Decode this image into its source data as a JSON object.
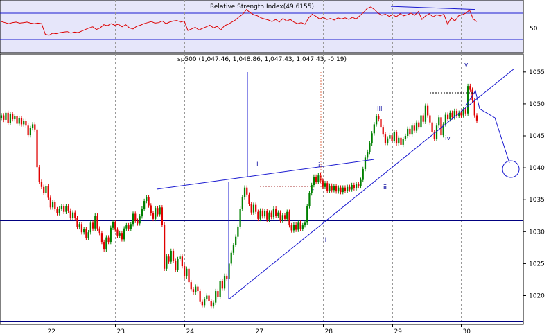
{
  "chart_data": [
    {
      "type": "line",
      "title": "Relative Strength Index(49.6155)",
      "y_ticks": [
        50
      ],
      "ylim": [
        0,
        100
      ],
      "reference_levels": [
        70,
        30
      ],
      "line_color": "#dd0000",
      "background": "#e6e6fa",
      "series": [
        {
          "values": [
            59,
            57,
            55,
            57,
            58,
            56,
            57,
            58,
            56,
            55,
            56,
            55,
            35,
            33,
            37,
            36,
            38,
            39,
            40,
            37,
            39,
            38,
            41,
            44,
            47,
            49,
            44,
            47,
            53,
            51,
            55,
            52,
            54,
            49,
            53,
            47,
            45,
            50,
            52,
            55,
            57,
            59,
            56,
            57,
            60,
            55,
            58,
            60,
            61,
            58,
            60,
            42,
            45,
            48,
            43,
            46,
            49,
            52,
            47,
            50,
            43,
            51,
            54,
            58,
            62,
            68,
            73,
            82,
            76,
            72,
            70,
            66,
            64,
            62,
            59,
            63,
            58,
            65,
            60,
            63,
            58,
            55,
            57,
            54,
            66,
            73,
            69,
            64,
            67,
            63,
            65,
            62,
            66,
            64,
            66,
            63,
            67,
            64,
            70,
            76,
            84,
            87,
            82,
            75,
            71,
            73,
            69,
            72,
            68,
            74,
            70,
            72,
            75,
            71,
            78,
            63,
            70,
            74,
            68,
            72,
            70,
            73,
            54,
            66,
            60,
            70,
            72,
            75,
            81,
            64,
            59
          ]
        }
      ],
      "trendlines": [
        {
          "x1": 119,
          "y1": 88,
          "x2": 142,
          "y2": 82
        }
      ]
    },
    {
      "type": "candlestick",
      "title": "sp500 (1,047.46, 1,048.86, 1,047.43, 1,047.43, -0.19)",
      "x_tick_labels": [
        "22",
        "23",
        "24",
        "27",
        "28",
        "29",
        "30"
      ],
      "y_ticks": [
        1020,
        1025,
        1030,
        1035,
        1040,
        1045,
        1050,
        1055
      ],
      "ylim": [
        1015.5,
        1057.8
      ],
      "up_color": "#008000",
      "down_color": "#e00000",
      "horizontal_levels": [
        {
          "value": 1055.2,
          "color": "#000080"
        },
        {
          "value": 1038.6,
          "color": "#66bb66"
        },
        {
          "value": 1031.8,
          "color": "#000080"
        },
        {
          "value": 1016.0,
          "color": "#000080"
        }
      ],
      "series": [
        {
          "name": "close",
          "values": [
            1048.2,
            1047.5,
            1048.6,
            1047.0,
            1048.4,
            1047.6,
            1048.1,
            1046.9,
            1047.8,
            1046.8,
            1047.3,
            1046.6,
            1045.1,
            1046.2,
            1046.8,
            1046.0,
            1040.1,
            1037.8,
            1037.0,
            1036.1,
            1037.1,
            1035.3,
            1033.8,
            1034.6,
            1033.5,
            1032.9,
            1033.6,
            1034.0,
            1033.1,
            1034.0,
            1033.3,
            1032.2,
            1033.0,
            1032.1,
            1030.7,
            1031.2,
            1029.9,
            1030.4,
            1029.0,
            1029.9,
            1031.4,
            1030.5,
            1032.5,
            1030.5,
            1029.8,
            1028.4,
            1027.2,
            1029.1,
            1028.4,
            1030.6,
            1031.5,
            1030.3,
            1029.4,
            1029.8,
            1028.8,
            1030.5,
            1031.0,
            1030.4,
            1031.2,
            1032.8,
            1031.7,
            1031.3,
            1032.4,
            1033.6,
            1034.8,
            1035.4,
            1034.1,
            1032.9,
            1032.0,
            1033.7,
            1032.7,
            1033.8,
            1031.1,
            1024.2,
            1026.1,
            1025.3,
            1027.0,
            1025.4,
            1024.0,
            1025.7,
            1026.1,
            1024.6,
            1023.0,
            1024.2,
            1022.1,
            1021.0,
            1020.5,
            1021.4,
            1020.7,
            1019.0,
            1018.5,
            1019.4,
            1020.0,
            1019.1,
            1018.3,
            1018.9,
            1020.7,
            1019.8,
            1022.3,
            1021.1,
            1023.1,
            1022.6,
            1025.0,
            1026.7,
            1027.9,
            1029.2,
            1030.8,
            1033.6,
            1035.4,
            1036.9,
            1035.8,
            1034.3,
            1033.0,
            1034.2,
            1033.1,
            1032.0,
            1033.3,
            1032.4,
            1033.2,
            1031.9,
            1033.0,
            1032.3,
            1033.6,
            1032.5,
            1033.0,
            1031.7,
            1032.6,
            1032.0,
            1033.1,
            1031.0,
            1030.2,
            1031.1,
            1030.3,
            1031.4,
            1030.4,
            1031.0,
            1031.4,
            1034.0,
            1036.0,
            1037.3,
            1038.6,
            1037.8,
            1038.8,
            1038.0,
            1037.0,
            1037.6,
            1036.4,
            1037.2,
            1036.5,
            1037.1,
            1036.3,
            1036.9,
            1036.2,
            1036.9,
            1036.4,
            1037.0,
            1036.6,
            1037.3,
            1036.8,
            1037.4,
            1037.1,
            1038.1,
            1039.8,
            1041.6,
            1042.5,
            1043.8,
            1045.4,
            1046.8,
            1048.1,
            1047.6,
            1046.4,
            1045.2,
            1043.9,
            1044.6,
            1045.1,
            1044.2,
            1045.6,
            1043.8,
            1044.7,
            1043.6,
            1044.5,
            1045.0,
            1046.1,
            1045.2,
            1046.6,
            1045.8,
            1047.1,
            1046.4,
            1048.2,
            1047.2,
            1049.7,
            1048.2,
            1047.1,
            1045.6,
            1044.5,
            1046.6,
            1047.9,
            1045.1,
            1046.8,
            1048.3,
            1047.6,
            1048.6,
            1047.9,
            1048.9,
            1048.1,
            1048.6,
            1048.2,
            1049.1,
            1048.5,
            1052.8,
            1052.2,
            1050.6,
            1048.2,
            1047.4
          ]
        }
      ],
      "wave_labels": [
        "v",
        "iii",
        "iv",
        "i",
        "ii",
        "I",
        "i",
        "-",
        "ii",
        "II"
      ]
    }
  ]
}
